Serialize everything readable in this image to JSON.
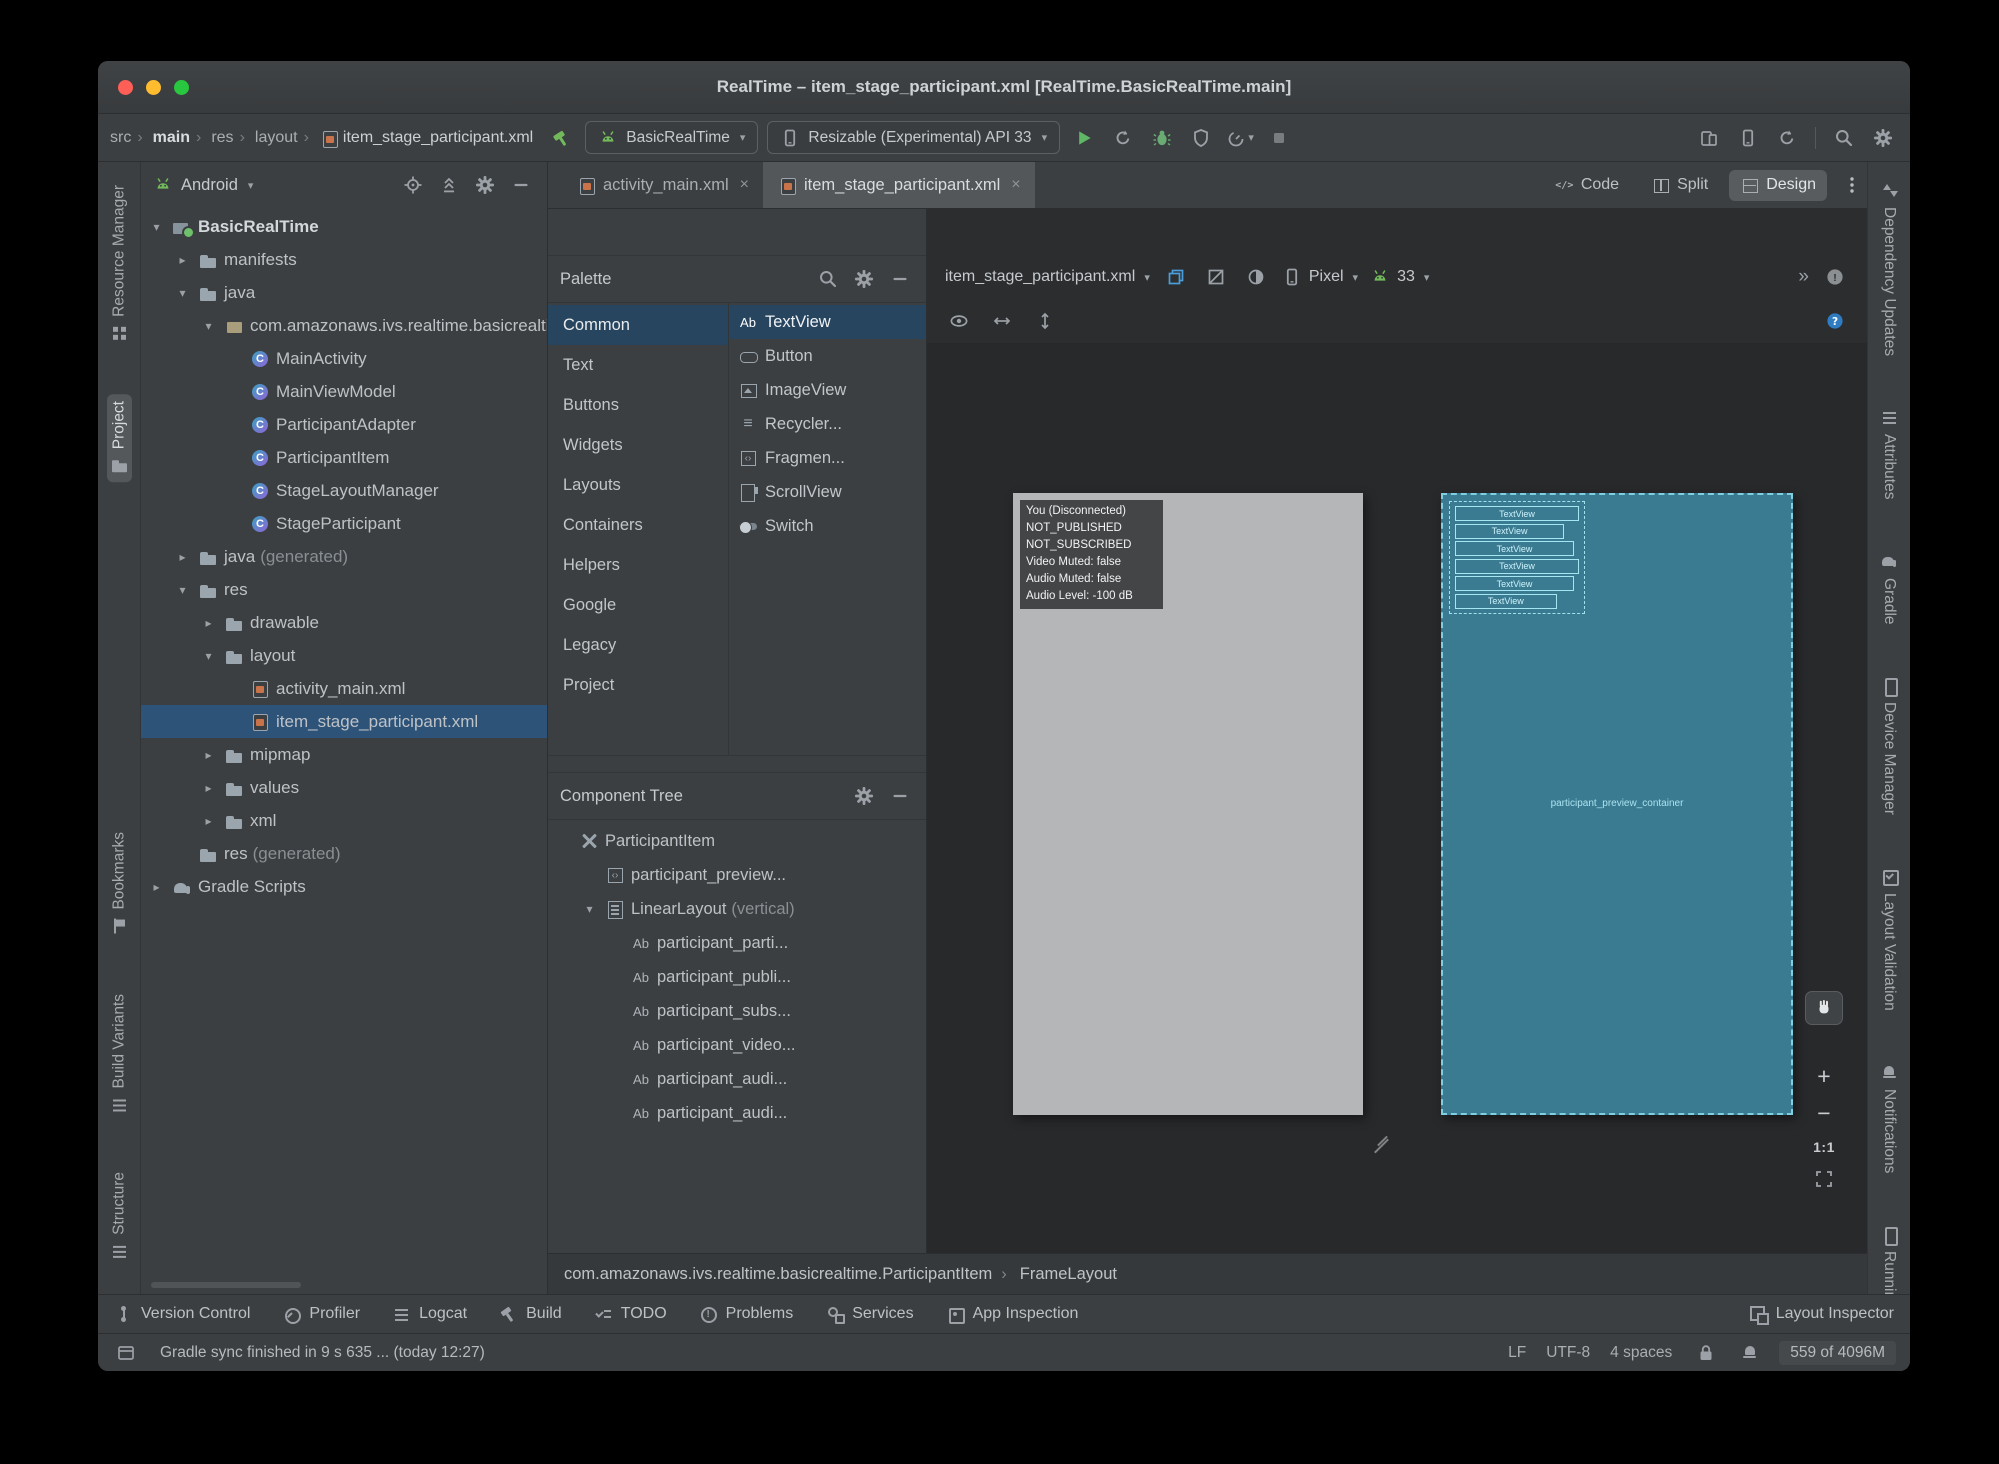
{
  "window": {
    "title": "RealTime – item_stage_participant.xml [RealTime.BasicRealTime.main]"
  },
  "main_toolbar": {
    "breadcrumbs": [
      {
        "label": "src"
      },
      {
        "label": "main",
        "bold": true
      },
      {
        "label": "res"
      },
      {
        "label": "layout"
      },
      {
        "label": "item_stage_participant.xml",
        "icon": "layoutfile"
      }
    ],
    "run_config": "BasicRealTime",
    "device_selector": "Resizable (Experimental) API 33"
  },
  "left_stripe": {
    "top": [
      {
        "label": "Resource Manager",
        "icon": "grid"
      },
      {
        "label": "Project",
        "icon": "folder2",
        "active": true
      }
    ],
    "bottom": [
      {
        "label": "Bookmarks",
        "icon": "flag"
      },
      {
        "label": "Build Variants",
        "icon": "sliders"
      },
      {
        "label": "Structure",
        "icon": "bars"
      }
    ]
  },
  "right_stripe": {
    "items": [
      {
        "label": "Dependency Updates",
        "icon": "updown"
      },
      {
        "label": "Attributes",
        "icon": "sliders"
      },
      {
        "label": "Gradle",
        "icon": "elephant"
      },
      {
        "label": "Device Manager",
        "icon": "phone2"
      },
      {
        "label": "Layout Validation",
        "icon": "checksq"
      },
      {
        "label": "Notifications",
        "icon": "bell"
      },
      {
        "label": "Running De",
        "icon": "phone2"
      }
    ]
  },
  "project": {
    "mode": "Android",
    "tree": [
      {
        "label": "BasicRealTime",
        "icon": "module",
        "indent": 0,
        "arrow": "open",
        "bold": true
      },
      {
        "label": "manifests",
        "icon": "folder",
        "indent": 1,
        "arrow": "closed"
      },
      {
        "label": "java",
        "icon": "folder",
        "indent": 1,
        "arrow": "open"
      },
      {
        "label": "com.amazonaws.ivs.realtime.basicrealtime",
        "icon": "package",
        "indent": 2,
        "arrow": "open"
      },
      {
        "label": "MainActivity",
        "icon": "class",
        "indent": 3
      },
      {
        "label": "MainViewModel",
        "icon": "class",
        "indent": 3
      },
      {
        "label": "ParticipantAdapter",
        "icon": "class",
        "indent": 3
      },
      {
        "label": "ParticipantItem",
        "icon": "class",
        "indent": 3
      },
      {
        "label": "StageLayoutManager",
        "icon": "class",
        "indent": 3
      },
      {
        "label": "StageParticipant",
        "icon": "class",
        "indent": 3
      },
      {
        "label": "java",
        "suffix": "(generated)",
        "icon": "folder",
        "indent": 1,
        "arrow": "closed"
      },
      {
        "label": "res",
        "icon": "folder",
        "indent": 1,
        "arrow": "open"
      },
      {
        "label": "drawable",
        "icon": "folder",
        "indent": 2,
        "arrow": "closed"
      },
      {
        "label": "layout",
        "icon": "folder",
        "indent": 2,
        "arrow": "open"
      },
      {
        "label": "activity_main.xml",
        "icon": "layoutfile",
        "indent": 3
      },
      {
        "label": "item_stage_participant.xml",
        "icon": "layoutfile",
        "indent": 3,
        "selected": true
      },
      {
        "label": "mipmap",
        "icon": "folder",
        "indent": 2,
        "arrow": "closed"
      },
      {
        "label": "values",
        "icon": "folder",
        "indent": 2,
        "arrow": "closed"
      },
      {
        "label": "xml",
        "icon": "folder",
        "indent": 2,
        "arrow": "closed"
      },
      {
        "label": "res",
        "suffix": "(generated)",
        "icon": "folder",
        "indent": 1
      },
      {
        "label": "Gradle Scripts",
        "icon": "gradle",
        "indent": 0,
        "arrow": "closed"
      }
    ]
  },
  "editor": {
    "tabs": [
      {
        "label": "activity_main.xml",
        "icon": "layoutfile"
      },
      {
        "label": "item_stage_participant.xml",
        "icon": "layoutfile",
        "active": true
      }
    ],
    "view_modes": [
      {
        "label": "Code",
        "icon": "codev"
      },
      {
        "label": "Split",
        "icon": "splitv"
      },
      {
        "label": "Design",
        "icon": "designv",
        "active": true
      }
    ]
  },
  "palette": {
    "title": "Palette",
    "categories": [
      {
        "label": "Common",
        "selected": true
      },
      {
        "label": "Text"
      },
      {
        "label": "Buttons"
      },
      {
        "label": "Widgets"
      },
      {
        "label": "Layouts"
      },
      {
        "label": "Containers"
      },
      {
        "label": "Helpers"
      },
      {
        "label": "Google"
      },
      {
        "label": "Legacy"
      },
      {
        "label": "Project"
      }
    ],
    "components": [
      {
        "label": "TextView",
        "icon": "ab",
        "selected": true
      },
      {
        "label": "Button",
        "icon": "button"
      },
      {
        "label": "ImageView",
        "icon": "image"
      },
      {
        "label": "Recycler...",
        "icon": "recycler"
      },
      {
        "label": "Fragmen...",
        "icon": "fragment"
      },
      {
        "label": "ScrollView",
        "icon": "scroll"
      },
      {
        "label": "Switch",
        "icon": "switch"
      }
    ]
  },
  "component_tree": {
    "title": "Component Tree",
    "items": [
      {
        "label": "ParticipantItem",
        "icon": "tools",
        "indent": 0
      },
      {
        "label": "participant_preview...",
        "icon": "fragment",
        "indent": 1
      },
      {
        "label": "LinearLayout",
        "suffix": "(vertical)",
        "icon": "linearv",
        "indent": 1,
        "arrow": "open"
      },
      {
        "label": "participant_parti...",
        "icon": "ab",
        "indent": 2
      },
      {
        "label": "participant_publi...",
        "icon": "ab",
        "indent": 2
      },
      {
        "label": "participant_subs...",
        "icon": "ab",
        "indent": 2
      },
      {
        "label": "participant_video...",
        "icon": "ab",
        "indent": 2
      },
      {
        "label": "participant_audi...",
        "icon": "ab",
        "indent": 2
      },
      {
        "label": "participant_audi...",
        "icon": "ab",
        "indent": 2
      }
    ]
  },
  "design": {
    "file_selector": "item_stage_participant.xml",
    "device_selector": "Pixel",
    "api_selector": "33",
    "overlay_lines": [
      "You (Disconnected)",
      "NOT_PUBLISHED",
      "NOT_SUBSCRIBED",
      "Video Muted: false",
      "Audio Muted: false",
      "Audio Level: -100 dB"
    ],
    "blueprint": {
      "textviews": [
        "TextView",
        "TextView",
        "TextView",
        "TextView",
        "TextView",
        "TextView"
      ],
      "container_label": "participant_preview_container"
    },
    "zoom_label": "1:1",
    "breadcrumb": [
      {
        "label": "com.amazonaws.ivs.realtime.basicrealtime.ParticipantItem"
      },
      {
        "label": "FrameLayout"
      }
    ]
  },
  "bottom_bar": {
    "items": [
      {
        "label": "Version Control",
        "icon": "branch"
      },
      {
        "label": "Profiler",
        "icon": "gauge"
      },
      {
        "label": "Logcat",
        "icon": "logcat"
      },
      {
        "label": "Build",
        "icon": "hammerb"
      },
      {
        "label": "TODO",
        "icon": "todo"
      },
      {
        "label": "Problems",
        "icon": "problem"
      },
      {
        "label": "Services",
        "icon": "services"
      },
      {
        "label": "App Inspection",
        "icon": "inspection"
      }
    ],
    "right_label": "Layout Inspector"
  },
  "status_bar": {
    "message": "Gradle sync finished in 9 s 635 ... (today 12:27)",
    "line_sep": "LF",
    "encoding": "UTF-8",
    "indent_config": "4 spaces",
    "memory": "559 of 4096M"
  },
  "colors": {
    "selection_blue": "#2d5379",
    "palette_selection": "#28455f",
    "blueprint_teal": "#3b7b92",
    "run_green": "#5fb865",
    "android_green": "#72b95c"
  }
}
